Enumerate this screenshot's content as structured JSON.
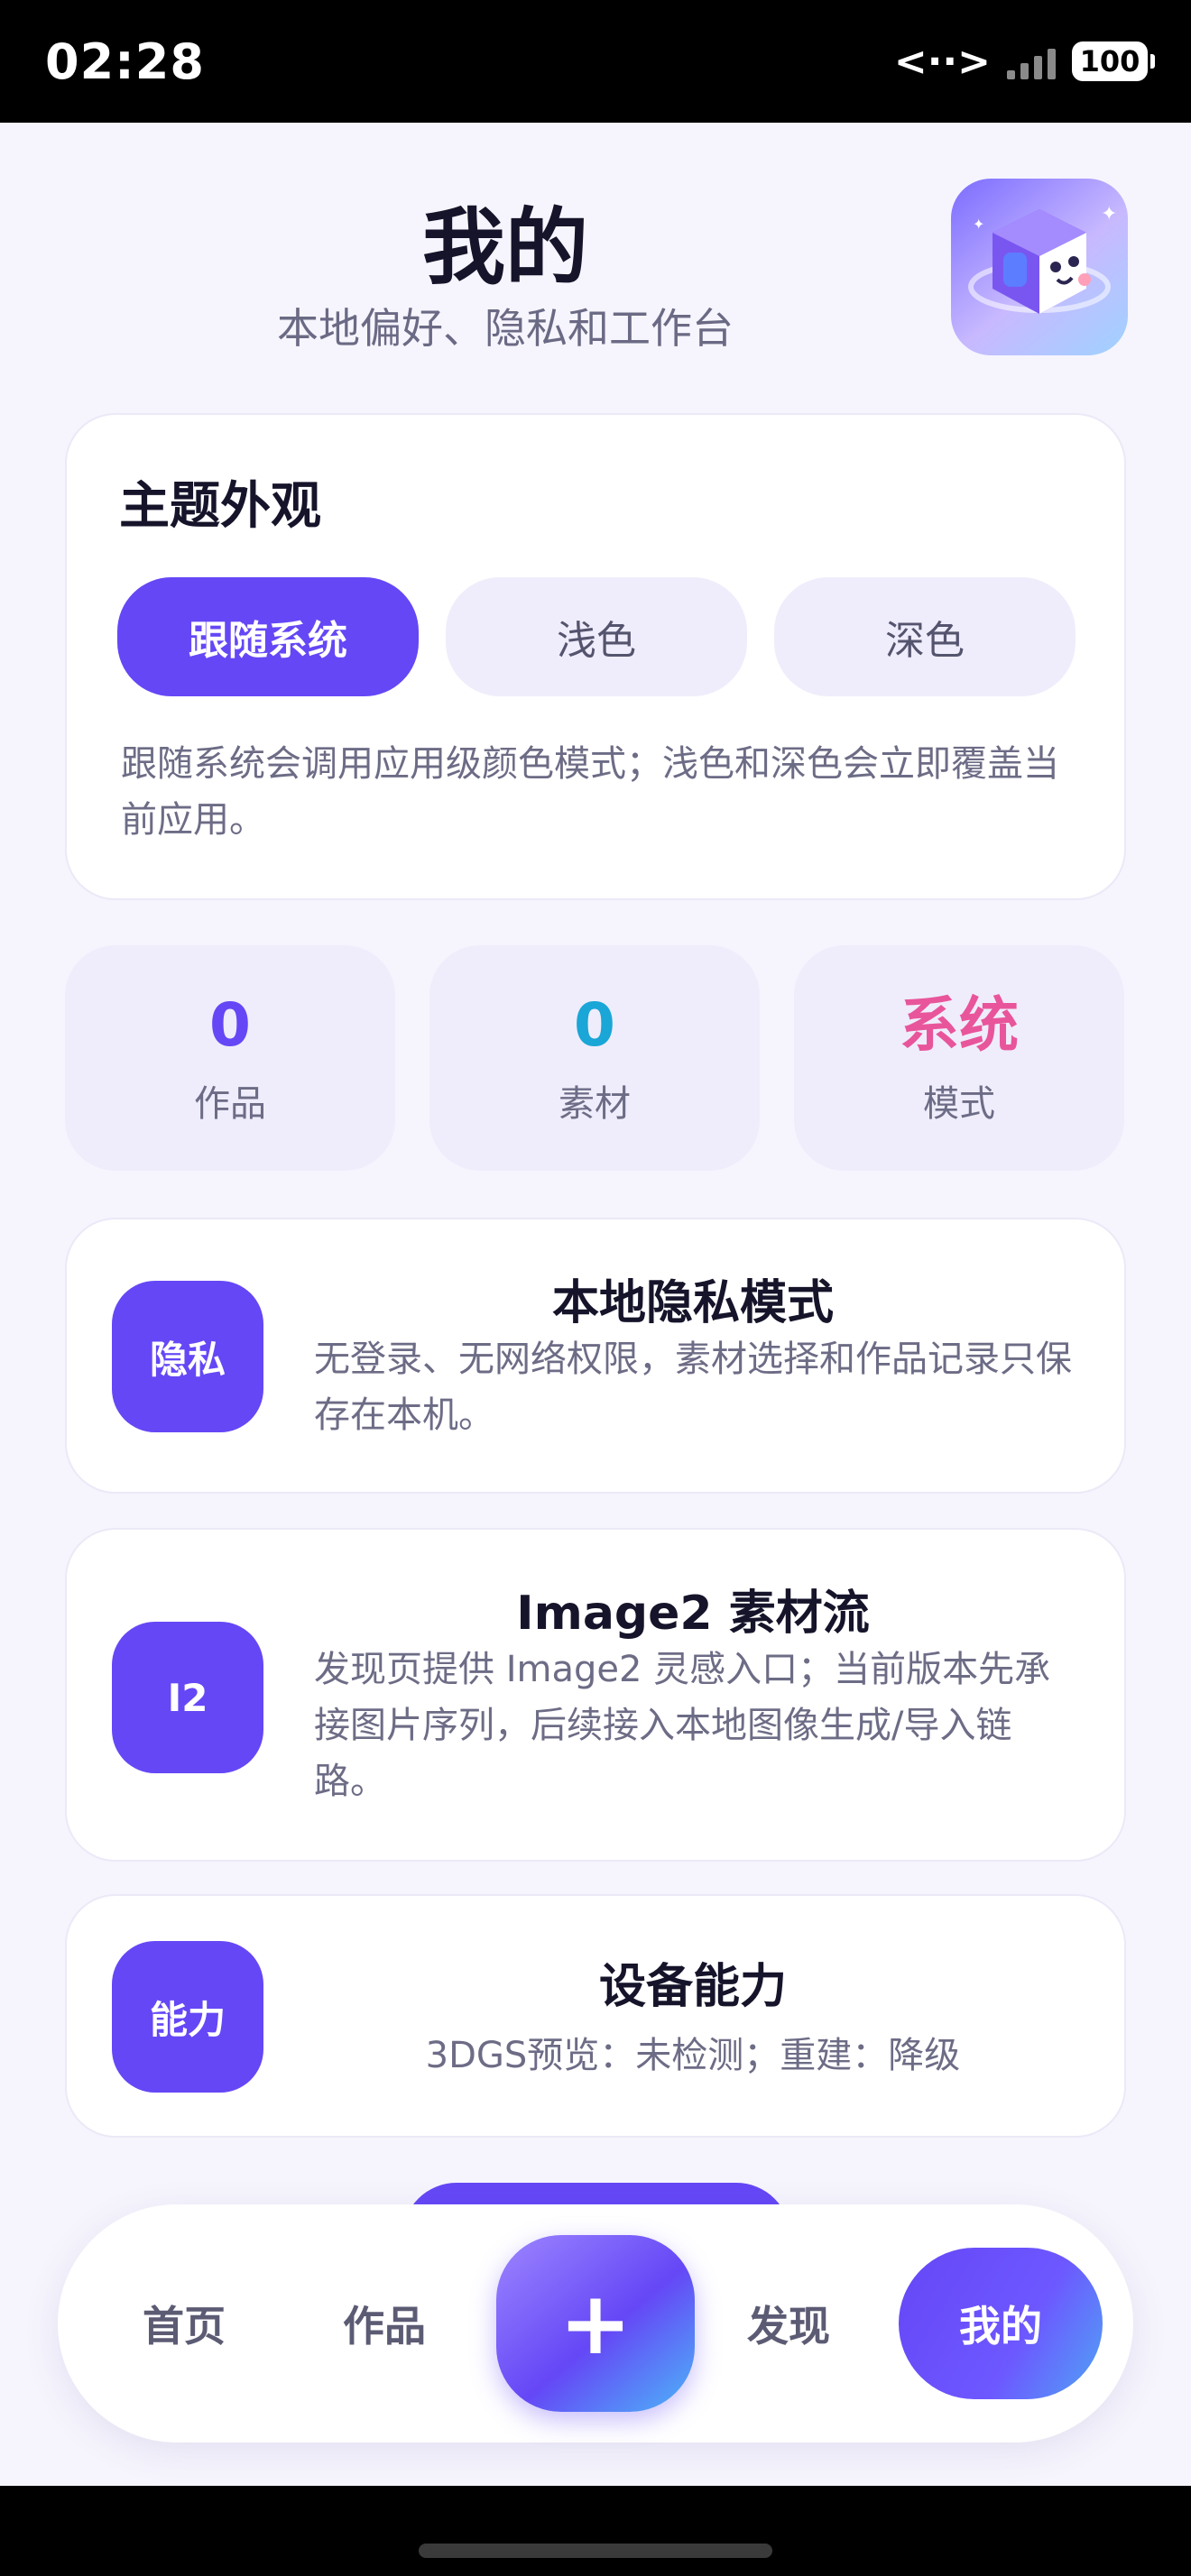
{
  "status_bar": {
    "time": "02:28",
    "network_icon": "<··>",
    "battery": "100"
  },
  "header": {
    "title": "我的",
    "subtitle": "本地偏好、隐私和工作台",
    "logo_icon": "cube-mascot-icon"
  },
  "theme": {
    "title": "主题外观",
    "options": [
      {
        "label": "跟随系统",
        "selected": true
      },
      {
        "label": "浅色",
        "selected": false
      },
      {
        "label": "深色",
        "selected": false
      }
    ],
    "note": "跟随系统会调用应用级颜色模式；浅色和深色会立即覆盖当前应用。"
  },
  "stats": [
    {
      "value": "0",
      "label": "作品",
      "color": "#6547f6"
    },
    {
      "value": "0",
      "label": "素材",
      "color": "#1aa6d6"
    },
    {
      "value": "系统",
      "label": "模式",
      "color": "#e8559b"
    }
  ],
  "info_cards": [
    {
      "badge": "隐私",
      "title": "本地隐私模式",
      "desc": "无登录、无网络权限，素材选择和作品记录只保存在本机。"
    },
    {
      "badge": "I2",
      "title": "Image2 素材流",
      "desc": "发现页提供 Image2 灵感入口；当前版本先承接图片序列，后续接入本地图像生成/导入链路。"
    },
    {
      "badge": "能力",
      "title": "设备能力",
      "desc": "3DGS预览：未检测；重建：降级"
    }
  ],
  "nav": {
    "home": "首页",
    "works": "作品",
    "add": "+",
    "discover": "发现",
    "mine": "我的"
  },
  "colors": {
    "accent": "#6547f6",
    "background": "#f6f5fd"
  }
}
